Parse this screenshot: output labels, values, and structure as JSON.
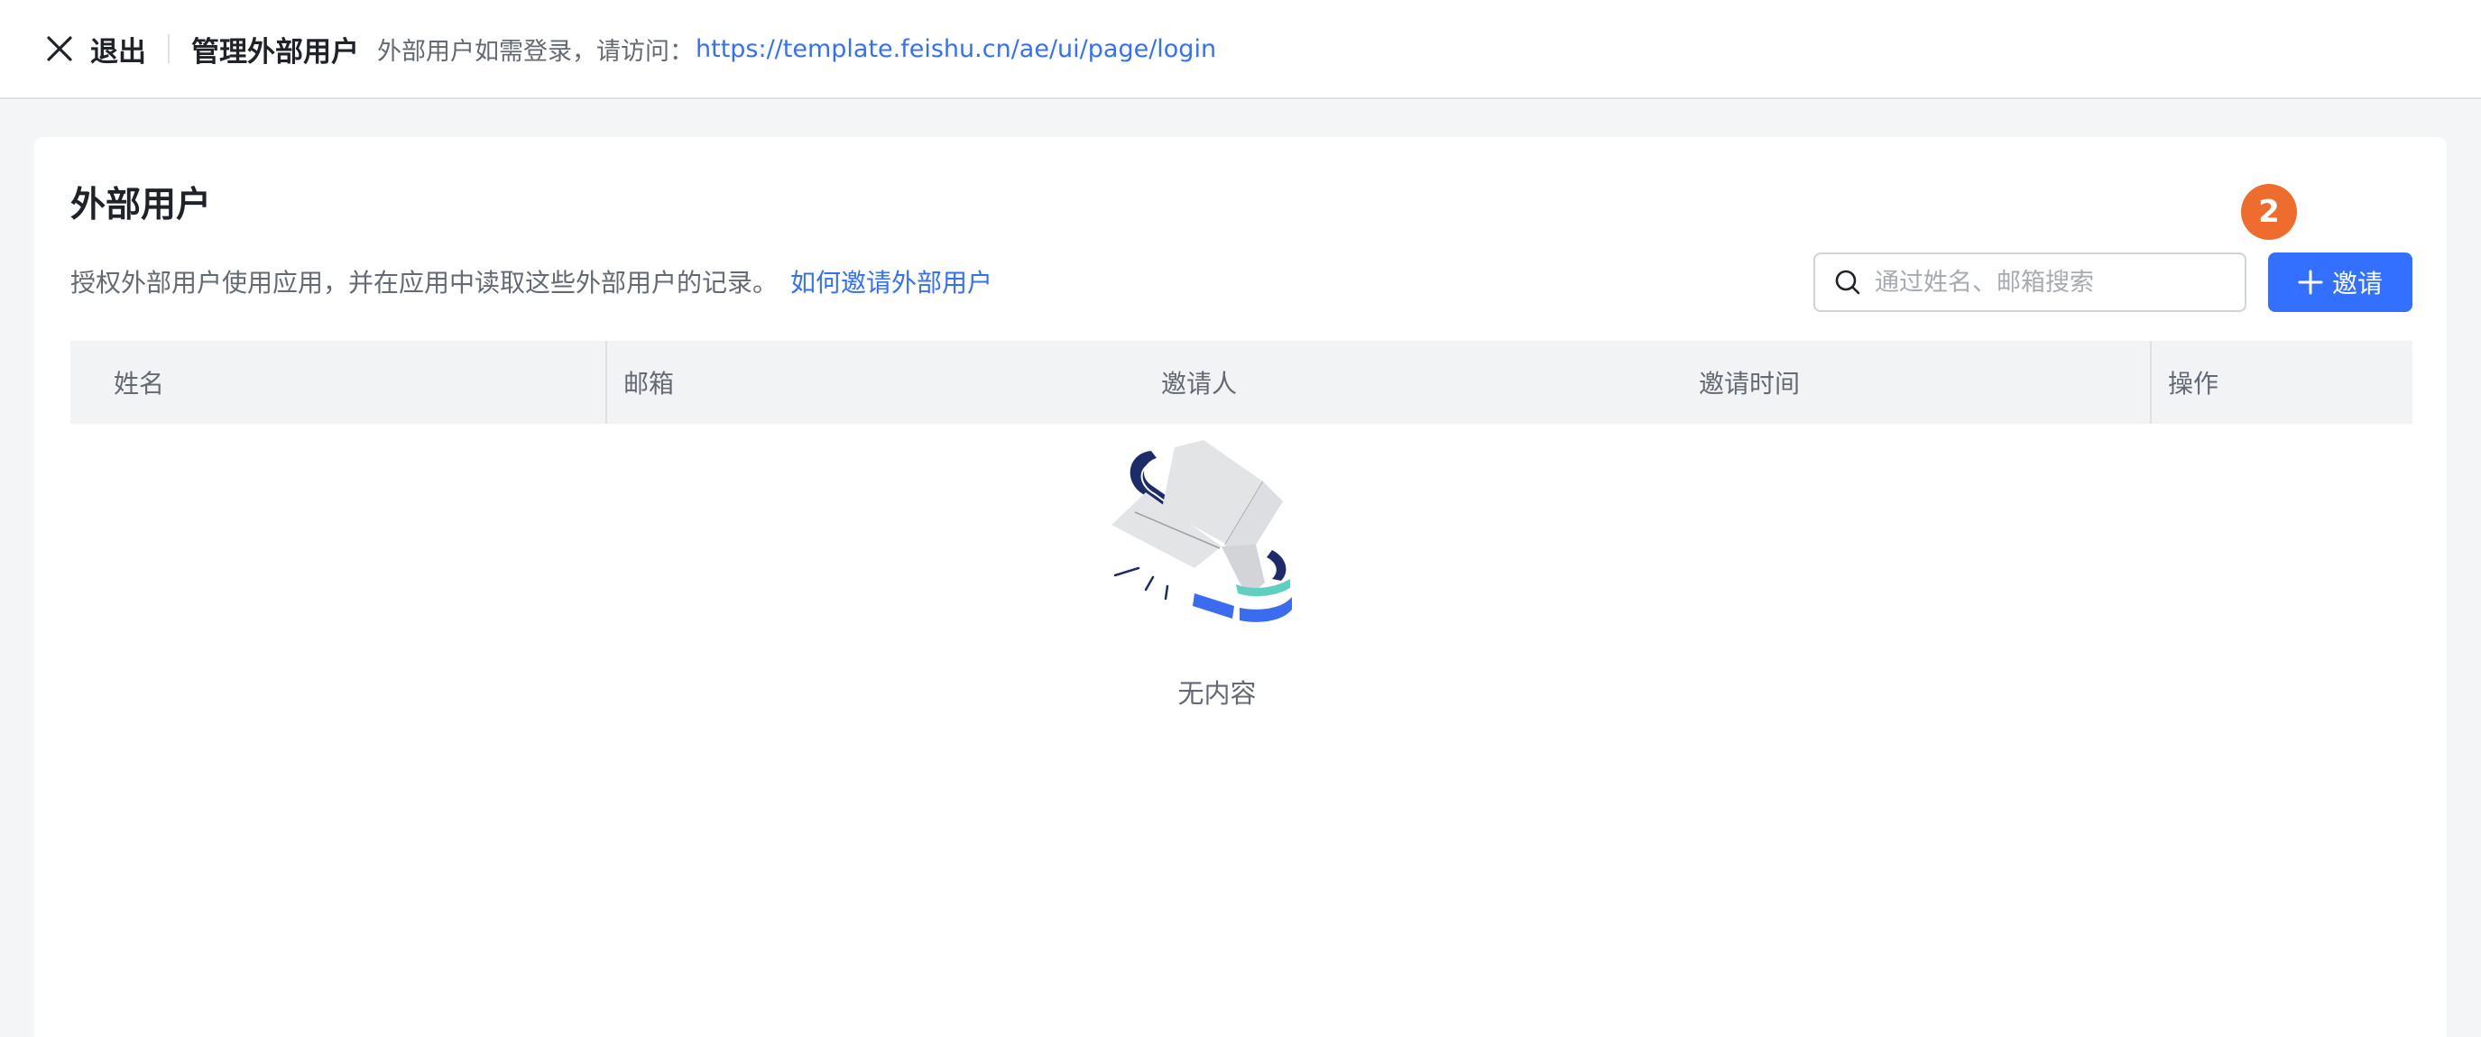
{
  "topbar": {
    "exit_label": "退出",
    "title": "管理外部用户",
    "hint": "外部用户如需登录，请访问：",
    "login_url": "https://template.feishu.cn/ae/ui/page/login"
  },
  "card": {
    "title": "外部用户",
    "description": "授权外部用户使用应用，并在应用中读取这些外部用户的记录。",
    "help_link": "如何邀请外部用户",
    "search_placeholder": "通过姓名、邮箱搜索",
    "invite_label": "邀请",
    "badge_count": "2"
  },
  "table": {
    "columns": [
      "姓名",
      "邮箱",
      "邀请人",
      "邀请时间",
      "操作"
    ],
    "rows": []
  },
  "empty_state": {
    "text": "无内容"
  },
  "colors": {
    "accent": "#3370ff",
    "badge": "#ef6c2f",
    "text_primary": "#1f2329",
    "text_secondary": "#646a73",
    "background": "#f4f5f7"
  },
  "icons": {
    "exit": "close-icon",
    "search": "search-icon",
    "invite": "plus-icon",
    "empty": "empty-box-illustration"
  }
}
